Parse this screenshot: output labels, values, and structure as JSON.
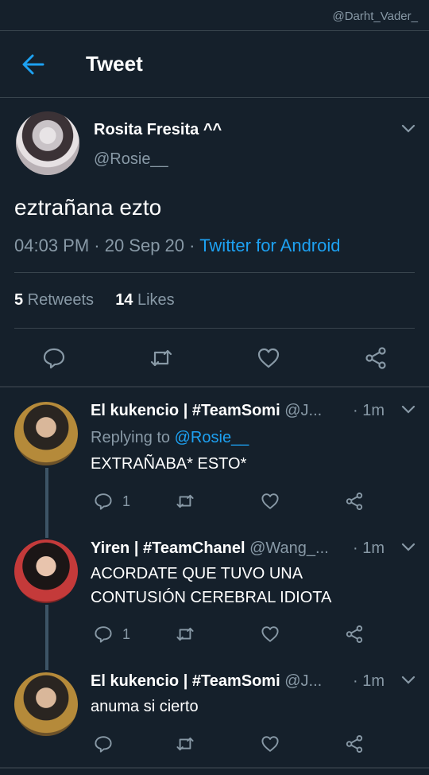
{
  "watermark": "@Darht_Vader_",
  "header": {
    "title": "Tweet",
    "back_icon": "arrow-left-icon"
  },
  "tweet": {
    "display_name": "Rosita Fresita ^^",
    "handle": "@Rosie__",
    "text": "eztrañana ezto",
    "time_date": "04:03 PM · 20 Sep 20 · ",
    "source": "Twitter for Android",
    "retweets_count": "5",
    "retweets_label": " Retweets",
    "likes_count": "14",
    "likes_label": " Likes"
  },
  "replies": [
    {
      "name": "El kukencio | #TeamSomi",
      "handle": " @J...",
      "time": "· 1m",
      "replying_prefix": "Replying to ",
      "replying_to": "@Rosie__",
      "text": "EXTRAÑABA* ESTO*",
      "reply_count": "1"
    },
    {
      "name": "Yiren | #TeamChanel",
      "handle": " @Wang_...",
      "time": "· 1m",
      "text": "ACORDATE QUE TUVO UNA CONTUSIÓN CEREBRAL IDIOTA",
      "reply_count": "1"
    },
    {
      "name": "El kukencio | #TeamSomi",
      "handle": " @J...",
      "time": "· 1m",
      "text": "anuma si cierto",
      "reply_count": ""
    }
  ],
  "colors": {
    "background": "#15202b",
    "accent": "#1da1f2",
    "muted": "#8899a6",
    "divider": "#38444d"
  }
}
